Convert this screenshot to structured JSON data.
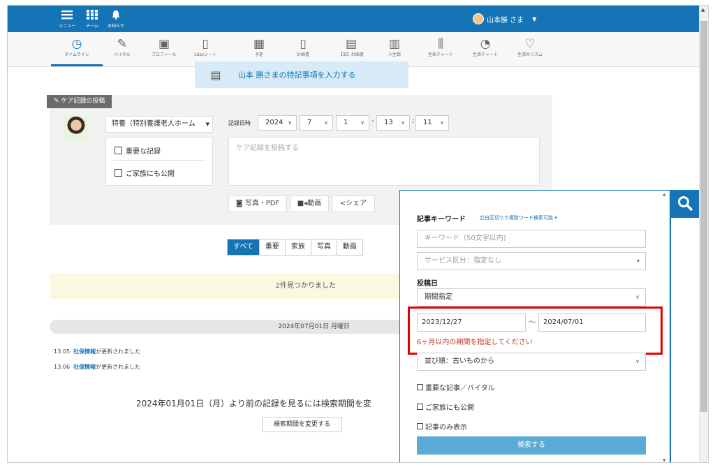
{
  "appbar": {
    "menu_label": "メニュー",
    "team_label": "チーム",
    "notice_label": "お知らせ",
    "user_name": "山本勝 さま"
  },
  "menubar": {
    "items": [
      {
        "label": "タイムライン",
        "icon": "clock-icon"
      },
      {
        "label": "バイタル",
        "icon": "thermometer-icon"
      },
      {
        "label": "プロフィール",
        "icon": "profile-card-icon"
      },
      {
        "label": "1dayシート",
        "icon": "clipboard-icon"
      },
      {
        "label": "予定",
        "icon": "calendar-icon"
      },
      {
        "label": "計画書",
        "icon": "clipboard-icon"
      },
      {
        "label": "【旧】計画書",
        "icon": "clipboard-person-icon"
      },
      {
        "label": "人生録",
        "icon": "book-icon"
      },
      {
        "label": "生命チャート",
        "icon": "bar-chart-icon"
      },
      {
        "label": "生活チャート",
        "icon": "pie-chart-icon"
      },
      {
        "label": "生活のリズム",
        "icon": "heart-pulse-icon"
      }
    ]
  },
  "notice": {
    "text": "山本 勝さまの特記事項を入力する"
  },
  "care": {
    "tab_label": "ケア記録の投稿",
    "facility": "特養（特別養護老人ホーム",
    "important_label": "重要な記録",
    "family_label": "ご家族にも公開",
    "date_label": "記録日時",
    "year": "2024",
    "month": "7",
    "day": "1",
    "hour": "13",
    "minute": "11",
    "post_placeholder": "ケア記録を投稿する",
    "photo_label": "写真・PDF",
    "video_label": "動画",
    "share_label": "シェア"
  },
  "filters": [
    "すべて",
    "重要",
    "家族",
    "写真",
    "動画"
  ],
  "timeline": {
    "found_text": "2件見つかりました",
    "day_header": "2024年07月01日 月曜日",
    "logs": [
      {
        "time": "13:05",
        "link": "社保情報",
        "text": "が更新されました"
      },
      {
        "time": "13:06",
        "link": "社保情報",
        "text": "が更新されました"
      }
    ],
    "older_message": "2024年01月01日（月）より前の記録を見るには検索期間を変",
    "change_period_label": "検索期間を変更する"
  },
  "search": {
    "keyword_title": "記事キーワード",
    "keyword_hint": "空白区切りで複数ワード検索可能",
    "keyword_placeholder": "キーワード（50文字以内)",
    "service_placeholder": "サービス区分：指定なし",
    "post_date_label": "投稿日",
    "period_value": "期間指定",
    "date_from": "2023/12/27",
    "tilde": "～",
    "date_to": "2024/07/01",
    "error": "6ヶ月以内の期間を指定してください",
    "sort_value": "並び順：古いものから",
    "check_important": "重要な記事／バイタル",
    "check_family": "ご家族にも公開",
    "check_only": "記事のみ表示",
    "submit_label": "検索する"
  },
  "colors": {
    "accent": "#1474b6",
    "error": "#c0392b",
    "highlight": "#e60000"
  }
}
